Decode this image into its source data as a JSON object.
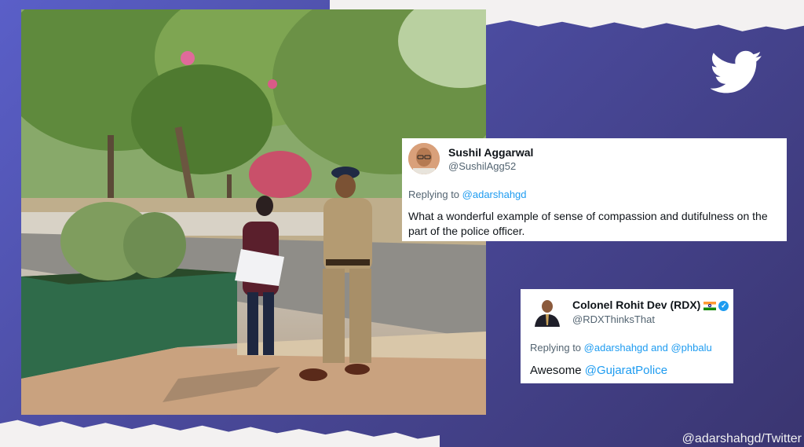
{
  "photo": {
    "description_icon": "photo-police-officer-walking-with-girl"
  },
  "tweets": [
    {
      "name": "Sushil Aggarwal",
      "handle": "@SushilAgg52",
      "reply_prefix": "Replying to ",
      "reply_to": "@adarshahgd",
      "text": "What a wonderful example of sense of compassion and dutifulness on the part of the police officer."
    },
    {
      "name": "Colonel Rohit Dev (RDX)",
      "handle": "@RDXThinksThat",
      "reply_prefix": "Replying to ",
      "reply_to_1": "@adarshahgd",
      "reply_and": " and ",
      "reply_to_2": "@phbalu",
      "text_prefix": "Awesome ",
      "text_mention": "@GujaratPolice"
    }
  ],
  "credit": "@adarshahgd/Twitter",
  "colors": {
    "background": "#4a4a9c",
    "link": "#1d9bf0",
    "twitter_logo": "#ffffff"
  }
}
